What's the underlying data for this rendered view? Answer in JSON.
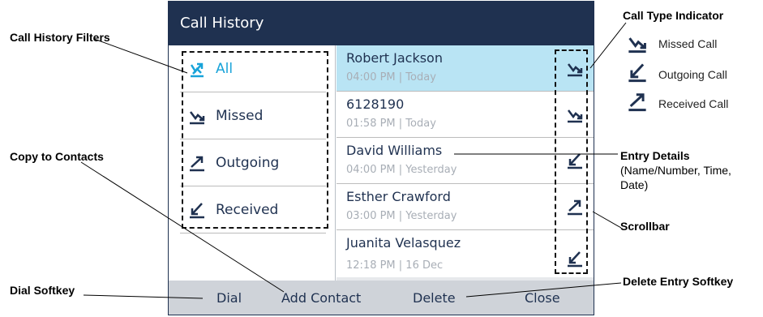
{
  "screen": {
    "title": "Call History",
    "filters": [
      {
        "label": "All",
        "icon": "all-calls-icon",
        "active": true
      },
      {
        "label": "Missed",
        "icon": "missed-call-icon",
        "active": false
      },
      {
        "label": "Outgoing",
        "icon": "outgoing-call-icon",
        "active": false
      },
      {
        "label": "Received",
        "icon": "received-call-icon",
        "active": false
      }
    ],
    "entries": [
      {
        "name": "Robert Jackson",
        "detail": "04:00 PM | Today",
        "type_icon": "missed-call-icon",
        "selected": true
      },
      {
        "name": "6128190",
        "detail": "01:58 PM | Today",
        "type_icon": "missed-call-icon",
        "selected": false
      },
      {
        "name": "David Williams",
        "detail": "04:00 PM | Yesterday",
        "type_icon": "outgoing-call-icon",
        "selected": false
      },
      {
        "name": "Esther Crawford",
        "detail": "03:00 PM | Yesterday",
        "type_icon": "received-call-icon",
        "selected": false
      },
      {
        "name": "Juanita Velasquez",
        "detail": "12:18 PM | 16 Dec",
        "type_icon": "outgoing-call-icon",
        "selected": false
      }
    ],
    "softkeys": {
      "dial": "Dial",
      "add_contact": "Add Contact",
      "delete": "Delete",
      "close": "Close"
    }
  },
  "callouts": {
    "filters": "Call History Filters",
    "copy": "Copy to Contacts",
    "dial": "Dial Softkey",
    "type_indicator": "Call Type Indicator",
    "entry_details_title": "Entry Details",
    "entry_details_note": "(Name/Number, Time, Date)",
    "scrollbar": "Scrollbar",
    "delete": "Delete Entry Softkey"
  },
  "legend": [
    {
      "label": "Missed Call",
      "icon": "missed-call-icon"
    },
    {
      "label": "Outgoing Call",
      "icon": "outgoing-call-icon"
    },
    {
      "label": "Received Call",
      "icon": "received-call-icon"
    }
  ],
  "colors": {
    "title_bar": "#1f3150",
    "accent": "#18a3d9",
    "selected_row": "#b9e4f4",
    "softkey_bar": "#cfd3d9",
    "text": "#1f3150"
  }
}
